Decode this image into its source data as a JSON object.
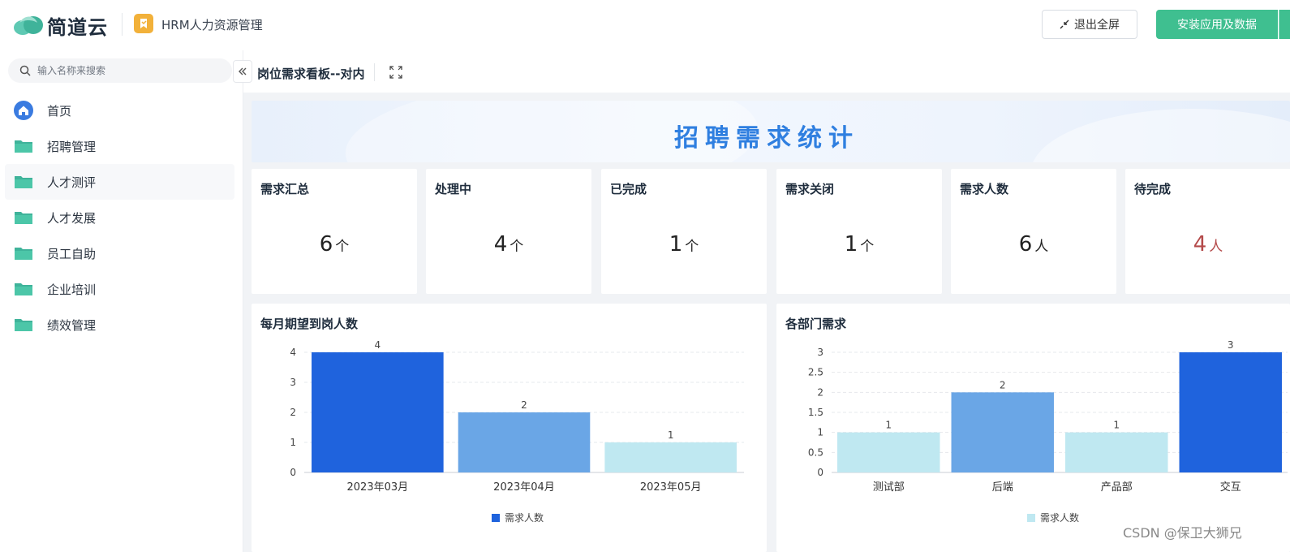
{
  "header": {
    "brand": "简道云",
    "app_title": "HRM人力资源管理",
    "exit_fullscreen_label": "退出全屏",
    "install_label": "安装应用及数据"
  },
  "sidebar": {
    "search_placeholder": "输入名称来搜索",
    "items": [
      {
        "label": "首页",
        "icon": "home-icon"
      },
      {
        "label": "招聘管理",
        "icon": "folder-icon"
      },
      {
        "label": "人才测评",
        "icon": "folder-icon"
      },
      {
        "label": "人才发展",
        "icon": "folder-icon"
      },
      {
        "label": "员工自助",
        "icon": "folder-icon"
      },
      {
        "label": "企业培训",
        "icon": "folder-icon"
      },
      {
        "label": "绩效管理",
        "icon": "folder-icon"
      }
    ]
  },
  "page": {
    "title": "岗位需求看板--对内",
    "banner_title": "招聘需求统计"
  },
  "stats": [
    {
      "label": "需求汇总",
      "value": "6",
      "unit": "个"
    },
    {
      "label": "处理中",
      "value": "4",
      "unit": "个"
    },
    {
      "label": "已完成",
      "value": "1",
      "unit": "个"
    },
    {
      "label": "需求关闭",
      "value": "1",
      "unit": "个"
    },
    {
      "label": "需求人数",
      "value": "6",
      "unit": "人"
    },
    {
      "label": "待完成",
      "value": "4",
      "unit": "人"
    }
  ],
  "colors": {
    "accent_green": "#3fbf90",
    "banner_blue": "#2f7fe0",
    "warn_red": "#b44a4a",
    "bar_dark": "#1f63dd",
    "bar_mid": "#6aa6e6",
    "bar_light": "#bfe8f1"
  },
  "chart_data": [
    {
      "type": "bar",
      "title": "每月期望到岗人数",
      "categories": [
        "2023年03月",
        "2023年04月",
        "2023年05月"
      ],
      "series": [
        {
          "name": "需求人数",
          "values": [
            4,
            2,
            1
          ]
        }
      ],
      "ylim": [
        0,
        4
      ],
      "yticks": [
        0,
        1,
        2,
        3,
        4
      ],
      "grid": true,
      "legend": "bottom"
    },
    {
      "type": "bar",
      "title": "各部门需求",
      "categories": [
        "测试部",
        "后端",
        "产品部",
        "交互"
      ],
      "series": [
        {
          "name": "需求人数",
          "values": [
            1,
            2,
            1,
            3
          ]
        }
      ],
      "ylim": [
        0,
        3
      ],
      "yticks": [
        0,
        0.5,
        1,
        1.5,
        2,
        2.5,
        3
      ],
      "grid": true,
      "legend": "bottom"
    }
  ],
  "watermark": "CSDN @保卫大狮兄"
}
